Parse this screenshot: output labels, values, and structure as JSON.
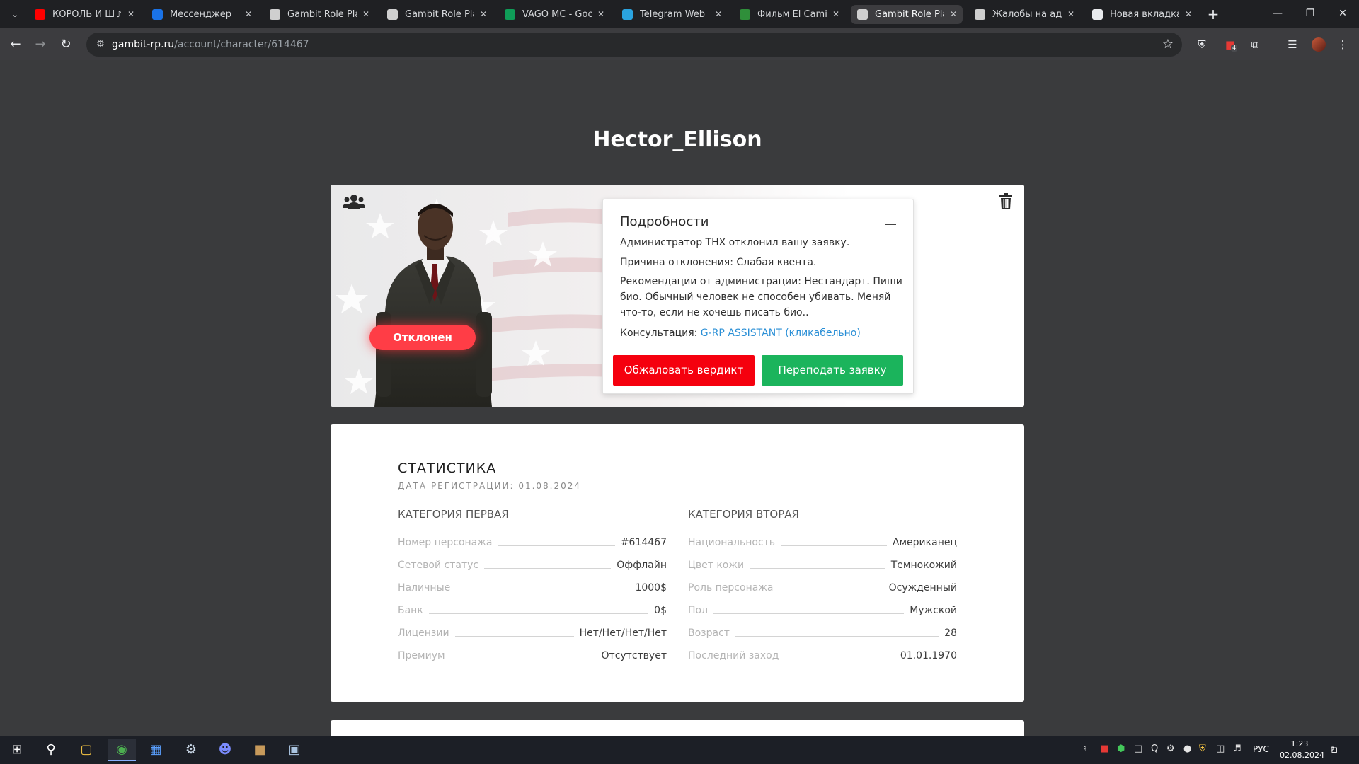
{
  "browser": {
    "tabs": [
      {
        "label": "КОРОЛЬ И Ш",
        "icon": "youtube-icon",
        "color": "#ff0000",
        "audio": true,
        "active": false
      },
      {
        "label": "Мессенджер",
        "icon": "messenger-icon",
        "color": "#1a73e8",
        "active": false
      },
      {
        "label": "Gambit Role Play",
        "icon": "gambit-icon",
        "color": "#cfcfcf",
        "active": false
      },
      {
        "label": "Gambit Role Play",
        "icon": "gambit-icon",
        "color": "#cfcfcf",
        "active": false
      },
      {
        "label": "VAGO MC - Goog",
        "icon": "sheets-icon",
        "color": "#0f9d58",
        "active": false
      },
      {
        "label": "Telegram Web",
        "icon": "telegram-icon",
        "color": "#2aa3df",
        "active": false
      },
      {
        "label": "Фильм El Camino",
        "icon": "film-icon",
        "color": "#2f8f3a",
        "active": false
      },
      {
        "label": "Gambit Role Play",
        "icon": "gambit-icon",
        "color": "#cfcfcf",
        "active": true
      },
      {
        "label": "Жалобы на адми",
        "icon": "gambit-icon",
        "color": "#cfcfcf",
        "active": false
      },
      {
        "label": "Новая вкладка",
        "icon": "chrome-icon",
        "color": "#e8eaed",
        "active": false
      }
    ],
    "url": {
      "host": "gambit-rp.ru",
      "path": "/account/character/614467"
    },
    "extension_badge": "4"
  },
  "character": {
    "name": "Hector_Ellison",
    "status": "Отклонен"
  },
  "details": {
    "title": "Подробности",
    "lines": [
      "Администратор THX отклонил вашу заявку.",
      "Причина отклонения: Слабая квента.",
      "Рекомендации от администрации: Нестандарт. Пиши био. Обычный человек не способен убивать. Меняй что-то, если не хочешь писать био.."
    ],
    "consult_label": "Консультация: ",
    "consult_link": "G-RP ASSISTANT (кликабельно)",
    "appeal_button": "Обжаловать вердикт",
    "resubmit_button": "Переподать заявку"
  },
  "stats": {
    "title": "СТАТИСТИКА",
    "registration": "ДАТА РЕГИСТРАЦИИ: 01.08.2024",
    "category_one": {
      "title": "КАТЕГОРИЯ ПЕРВАЯ",
      "rows": [
        {
          "label": "Номер персонажа",
          "value": "#614467"
        },
        {
          "label": "Сетевой статус",
          "value": "Оффлайн"
        },
        {
          "label": "Наличные",
          "value": "1000$"
        },
        {
          "label": "Банк",
          "value": "0$"
        },
        {
          "label": "Лицензии",
          "value": "Нет/Нет/Нет/Нет"
        },
        {
          "label": "Премиум",
          "value": "Отсутствует"
        }
      ]
    },
    "category_two": {
      "title": "КАТЕГОРИЯ ВТОРАЯ",
      "rows": [
        {
          "label": "Национальность",
          "value": "Американец"
        },
        {
          "label": "Цвет кожи",
          "value": "Темнокожий"
        },
        {
          "label": "Роль персонажа",
          "value": "Осужденный"
        },
        {
          "label": "Пол",
          "value": "Мужской"
        },
        {
          "label": "Возраст",
          "value": "28"
        },
        {
          "label": "Последний заход",
          "value": "01.01.1970"
        }
      ]
    }
  },
  "taskbar": {
    "lang": "РУС",
    "time": "1:23",
    "date": "02.08.2024",
    "notifications": "2"
  },
  "colors": {
    "reject": "#ff3d46",
    "appeal": "#f5000e",
    "resubmit": "#1bb45c",
    "link": "#2a8fd6"
  }
}
